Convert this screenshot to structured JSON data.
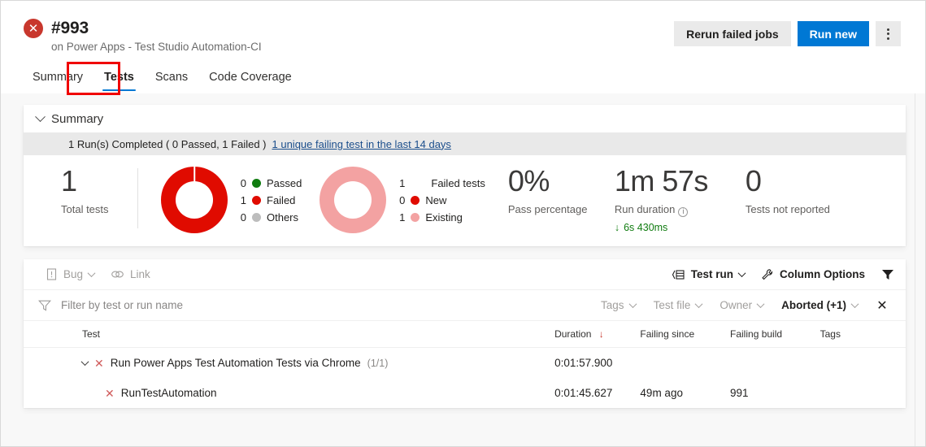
{
  "header": {
    "status_icon": "error-circle-icon",
    "build_number": "#993",
    "subtitle": "on Power Apps - Test Studio Automation-CI",
    "tabs": [
      {
        "label": "Summary",
        "active": false
      },
      {
        "label": "Tests",
        "active": true
      },
      {
        "label": "Scans",
        "active": false
      },
      {
        "label": "Code Coverage",
        "active": false
      }
    ],
    "actions": {
      "rerun_label": "Rerun failed jobs",
      "run_new_label": "Run new",
      "more_icon": "kebab-menu-icon",
      "primary_color": "#0078d4"
    }
  },
  "summary": {
    "section_title": "Summary",
    "collapse_icon": "chevron-down-icon",
    "strip_text": "1 Run(s) Completed ( 0 Passed, 1 Failed )",
    "strip_link": "1 unique failing test in the last 14 days",
    "metrics": {
      "total_tests": {
        "value": "1",
        "label": "Total tests"
      },
      "pass_percentage": {
        "value": "0%",
        "label": "Pass percentage"
      },
      "run_duration": {
        "value": "1m 57s",
        "label": "Run duration",
        "info_icon": "info-icon",
        "delta": "6s 430ms",
        "delta_icon": "arrow-down-icon",
        "delta_color": "#107c10"
      },
      "tests_not_reported": {
        "value": "0",
        "label": "Tests not reported"
      }
    },
    "outcome_chart": {
      "legend": [
        {
          "count": "0",
          "label": "Passed",
          "color": "#107c10"
        },
        {
          "count": "1",
          "label": "Failed",
          "color": "#e00b00"
        },
        {
          "count": "0",
          "label": "Others",
          "color": "#bdbdbd"
        }
      ]
    },
    "failure_chart": {
      "legend": [
        {
          "count": "1",
          "label": "Failed tests",
          "color": ""
        },
        {
          "count": "0",
          "label": "New",
          "color": "#e00b00"
        },
        {
          "count": "1",
          "label": "Existing",
          "color": "#f3a2a2"
        }
      ]
    }
  },
  "chart_data": [
    {
      "type": "pie",
      "title": "Test outcome",
      "categories": [
        "Passed",
        "Failed",
        "Others"
      ],
      "values": [
        0,
        1,
        0
      ],
      "colors": [
        "#107c10",
        "#e00b00",
        "#bdbdbd"
      ],
      "legend": "right"
    },
    {
      "type": "pie",
      "title": "Failed tests",
      "categories": [
        "New",
        "Existing"
      ],
      "values": [
        0,
        1
      ],
      "colors": [
        "#e00b00",
        "#f3a2a2"
      ],
      "legend": "right"
    }
  ],
  "toolbar": {
    "bug_label": "Bug",
    "bug_icon": "bug-document-icon",
    "bug_caret": "chevron-down-icon",
    "link_label": "Link",
    "link_icon": "link-icon",
    "group_label": "Test run",
    "group_icon": "group-list-icon",
    "group_caret": "chevron-down-icon",
    "column_options_label": "Column Options",
    "column_options_icon": "wrench-icon",
    "filter_icon": "funnel-filled-icon"
  },
  "filters": {
    "filter_icon": "funnel-icon",
    "placeholder": "Filter by test or run name",
    "value": "",
    "pills": [
      {
        "label": "Tags",
        "active": false
      },
      {
        "label": "Test file",
        "active": false
      },
      {
        "label": "Owner",
        "active": false
      },
      {
        "label": "Aborted (+1)",
        "active": true
      }
    ],
    "clear_icon": "close-icon"
  },
  "table": {
    "columns": [
      "Test",
      "Duration",
      "Failing since",
      "Failing build",
      "Tags"
    ],
    "sort_column": "Duration",
    "sort_icon": "arrow-down-icon",
    "rows": [
      {
        "type": "group",
        "expand_icon": "chevron-down-icon",
        "status_icon": "x-mark-icon",
        "name": "Run Power Apps Test Automation Tests via Chrome",
        "count": "(1/1)",
        "duration": "0:01:57.900",
        "failing_since": "",
        "failing_build": "",
        "tags": ""
      },
      {
        "type": "child",
        "status_icon": "x-mark-icon",
        "name": "RunTestAutomation",
        "duration": "0:01:45.627",
        "failing_since": "49m ago",
        "failing_build": "991",
        "tags": ""
      }
    ]
  }
}
